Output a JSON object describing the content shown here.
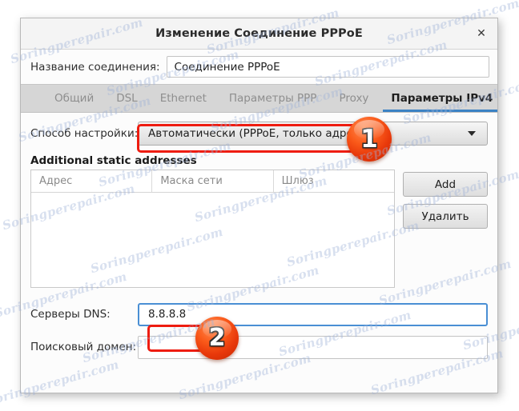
{
  "window": {
    "title": "Изменение Соединение PPPoE",
    "close_label": "✕"
  },
  "connection": {
    "name_label": "Название соединения:",
    "name_value": "Соединение PPPoE"
  },
  "tabs": [
    {
      "label": "Общий",
      "active": false
    },
    {
      "label": "DSL",
      "active": false
    },
    {
      "label": "Ethernet",
      "active": false
    },
    {
      "label": "Параметры PPP",
      "active": false
    },
    {
      "label": "Proxy",
      "active": false
    },
    {
      "label": "Параметры IPv4",
      "active": true
    }
  ],
  "method": {
    "label": "Способ настройки:",
    "value": "Автоматически (PPPoE, только адрес)",
    "arrow_icon": "chevron-down-icon"
  },
  "static_addresses": {
    "title": "Additional static addresses",
    "columns": [
      "Адрес",
      "Маска сети",
      "Шлюз"
    ],
    "rows": [],
    "add_button": "Add",
    "delete_button": "Удалить"
  },
  "dns": {
    "label": "Серверы DNS:",
    "value": "8.8.8.8",
    "placeholder": ""
  },
  "search_domain": {
    "label": "Поисковый домен:",
    "value": "",
    "placeholder": ""
  },
  "annotations": [
    {
      "id": "1",
      "target": "method-combo"
    },
    {
      "id": "2",
      "target": "dns-input"
    }
  ],
  "colors": {
    "annotation_red": "#ee1c10",
    "badge_orange": "#fa5a1a",
    "active_tab_blue": "#3b82c4",
    "focus_blue": "#4a8fd4"
  },
  "watermark": {
    "text": "Soringperepair.com"
  }
}
